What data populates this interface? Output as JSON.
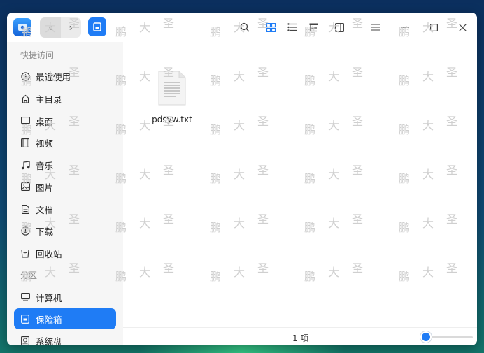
{
  "window": {
    "nav": {
      "back_glyph": "‹",
      "forward_glyph": "›"
    }
  },
  "toolbar": {
    "icons": [
      "search-icon",
      "icon-view-icon",
      "list-view-icon",
      "tree-view-icon",
      "detail-pane-icon",
      "menu-icon",
      "minimize-icon",
      "maximize-icon",
      "close-icon"
    ]
  },
  "sidebar": {
    "quick_access_label": "快捷访问",
    "partitions_label": "分区",
    "items": [
      {
        "label": "最近使用",
        "icon": "clock-icon"
      },
      {
        "label": "主目录",
        "icon": "home-icon"
      },
      {
        "label": "桌面",
        "icon": "desktop-icon"
      },
      {
        "label": "视频",
        "icon": "video-icon"
      },
      {
        "label": "音乐",
        "icon": "music-icon"
      },
      {
        "label": "图片",
        "icon": "picture-icon"
      },
      {
        "label": "文档",
        "icon": "document-icon"
      },
      {
        "label": "下载",
        "icon": "download-icon"
      },
      {
        "label": "回收站",
        "icon": "trash-icon"
      }
    ],
    "partition_items": [
      {
        "label": "计算机",
        "icon": "computer-icon"
      },
      {
        "label": "保险箱",
        "icon": "vault-icon",
        "active": true
      },
      {
        "label": "系统盘",
        "icon": "disk-icon"
      }
    ]
  },
  "main": {
    "files": [
      {
        "name": "pdsyw.txt",
        "type": "text"
      }
    ]
  },
  "statusbar": {
    "count_text": "1 项",
    "zoom_level": 0.1
  },
  "watermark": {
    "chars": [
      "鹏",
      "大",
      "圣"
    ]
  },
  "colors": {
    "accent": "#1f7cf5",
    "sidebar_bg": "#f6f6f6"
  }
}
